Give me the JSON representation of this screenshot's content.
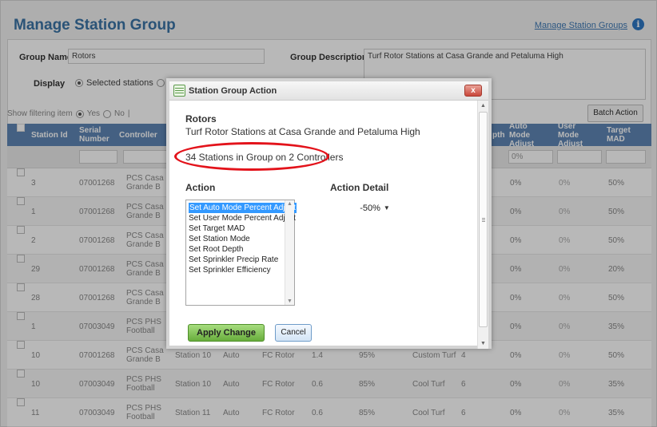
{
  "header": {
    "title": "Manage Station Group",
    "link": "Manage Station Groups",
    "info_icon": "i"
  },
  "form": {
    "group_name_label": "Group Name",
    "group_name_value": "Rotors",
    "group_description_label": "Group Description",
    "group_description_value": "Turf Rotor Stations at Casa Grande and Petaluma High",
    "display_label": "Display",
    "display_option_selected": "Selected stations"
  },
  "filter": {
    "label": "Show filtering item",
    "yes": "Yes",
    "no": "No",
    "separator": "|"
  },
  "batch_action_label": "Batch Action",
  "grid": {
    "headers": [
      "Station Id",
      "Serial Number",
      "Controller",
      "pth",
      "Auto Mode Adjust",
      "User Mode Adjust",
      "Target MAD"
    ],
    "filter_auto_value": "0%",
    "rows": [
      {
        "station_id": "3",
        "serial": "07001268",
        "controller": "PCS Casa Grande B",
        "station": "",
        "mode": "",
        "type": "",
        "precip": "",
        "eff": "",
        "turf": "",
        "depth": "",
        "auto": "0%",
        "user": "0%",
        "mad": "50%"
      },
      {
        "station_id": "1",
        "serial": "07001268",
        "controller": "PCS Casa Grande B",
        "station": "",
        "mode": "",
        "type": "",
        "precip": "",
        "eff": "",
        "turf": "",
        "depth": "",
        "auto": "0%",
        "user": "0%",
        "mad": "50%"
      },
      {
        "station_id": "2",
        "serial": "07001268",
        "controller": "PCS Casa Grande B",
        "station": "",
        "mode": "",
        "type": "",
        "precip": "",
        "eff": "",
        "turf": "",
        "depth": "",
        "auto": "0%",
        "user": "0%",
        "mad": "50%"
      },
      {
        "station_id": "29",
        "serial": "07001268",
        "controller": "PCS Casa Grande B",
        "station": "",
        "mode": "",
        "type": "",
        "precip": "",
        "eff": "",
        "turf": "",
        "depth": "",
        "auto": "0%",
        "user": "0%",
        "mad": "20%"
      },
      {
        "station_id": "28",
        "serial": "07001268",
        "controller": "PCS Casa Grande B",
        "station": "",
        "mode": "",
        "type": "",
        "precip": "",
        "eff": "",
        "turf": "",
        "depth": "",
        "auto": "0%",
        "user": "0%",
        "mad": "50%"
      },
      {
        "station_id": "1",
        "serial": "07003049",
        "controller": "PCS PHS Football",
        "station": "",
        "mode": "",
        "type": "",
        "precip": "",
        "eff": "",
        "turf": "",
        "depth": "",
        "auto": "0%",
        "user": "0%",
        "mad": "35%"
      },
      {
        "station_id": "10",
        "serial": "07001268",
        "controller": "PCS Casa Grande B",
        "station": "Station 10",
        "mode": "Auto",
        "type": "FC Rotor",
        "precip": "1.4",
        "eff": "95%",
        "turf": "Custom Turf",
        "depth": "4",
        "auto": "0%",
        "user": "0%",
        "mad": "50%"
      },
      {
        "station_id": "10",
        "serial": "07003049",
        "controller": "PCS PHS Football",
        "station": "Station 10",
        "mode": "Auto",
        "type": "FC Rotor",
        "precip": "0.6",
        "eff": "85%",
        "turf": "Cool Turf",
        "depth": "6",
        "auto": "0%",
        "user": "0%",
        "mad": "35%"
      },
      {
        "station_id": "11",
        "serial": "07003049",
        "controller": "PCS PHS Football",
        "station": "Station 11",
        "mode": "Auto",
        "type": "FC Rotor",
        "precip": "0.6",
        "eff": "85%",
        "turf": "Cool Turf",
        "depth": "6",
        "auto": "0%",
        "user": "0%",
        "mad": "35%"
      }
    ]
  },
  "dialog": {
    "title": "Station Group Action",
    "close_glyph": "x",
    "group_name": "Rotors",
    "group_description": "Turf Rotor Stations at Casa Grande and Petaluma High",
    "count_text": "34 Stations in Group on 2 Controllers",
    "action_label": "Action",
    "action_detail_label": "Action Detail",
    "actions": [
      "Set Auto Mode Percent Adjust",
      "Set User Mode Percent Adjust",
      "Set Target MAD",
      "Set Station Mode",
      "Set Root Depth",
      "Set Sprinkler Precip Rate",
      "Set Sprinkler Efficiency"
    ],
    "selected_action_index": 0,
    "detail_value": "-50%",
    "apply_label": "Apply Change",
    "cancel_label": "Cancel",
    "highlight_color": "#e3131b"
  }
}
